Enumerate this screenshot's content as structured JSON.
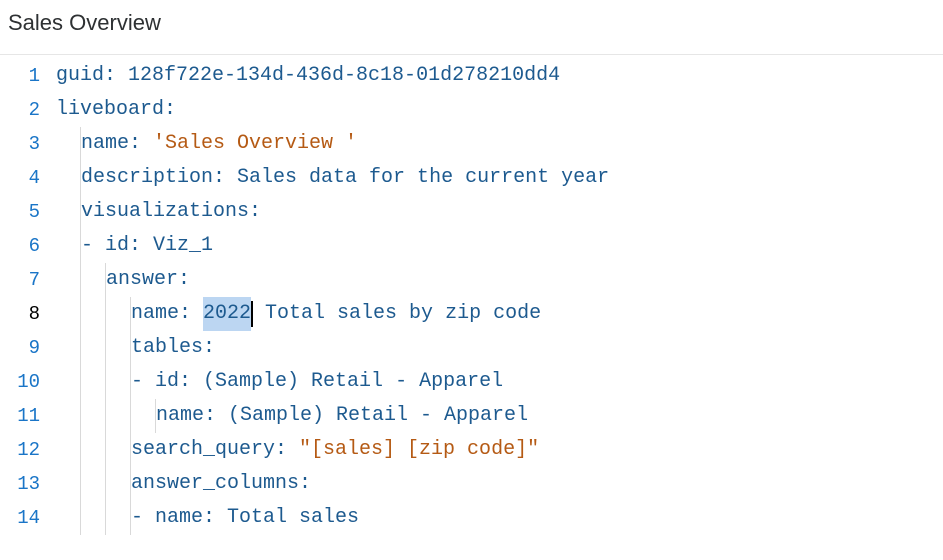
{
  "header": {
    "title": "Sales Overview"
  },
  "code": {
    "lines": [
      {
        "num": "1",
        "indent": 0,
        "guides": [],
        "segments": [
          {
            "t": "key",
            "v": "guid: "
          },
          {
            "t": "val",
            "v": "128f722e-134d-436d-8c18-01d278210dd4"
          }
        ]
      },
      {
        "num": "2",
        "indent": 0,
        "guides": [],
        "segments": [
          {
            "t": "key",
            "v": "liveboard:"
          }
        ]
      },
      {
        "num": "3",
        "indent": 2,
        "guides": [
          1
        ],
        "segments": [
          {
            "t": "key",
            "v": "name: "
          },
          {
            "t": "str",
            "v": "'Sales Overview '"
          }
        ]
      },
      {
        "num": "4",
        "indent": 2,
        "guides": [
          1
        ],
        "segments": [
          {
            "t": "key",
            "v": "description: "
          },
          {
            "t": "val",
            "v": "Sales data for the current year"
          }
        ]
      },
      {
        "num": "5",
        "indent": 2,
        "guides": [
          1
        ],
        "segments": [
          {
            "t": "key",
            "v": "visualizations:"
          }
        ]
      },
      {
        "num": "6",
        "indent": 2,
        "guides": [
          1
        ],
        "segments": [
          {
            "t": "dash",
            "v": "- "
          },
          {
            "t": "key",
            "v": "id: "
          },
          {
            "t": "val",
            "v": "Viz_1"
          }
        ]
      },
      {
        "num": "7",
        "indent": 4,
        "guides": [
          1,
          2
        ],
        "segments": [
          {
            "t": "key",
            "v": "answer:"
          }
        ]
      },
      {
        "num": "8",
        "indent": 6,
        "guides": [
          1,
          2,
          3
        ],
        "current": true,
        "segments": [
          {
            "t": "key",
            "v": "name: "
          },
          {
            "t": "sel",
            "v": "2022"
          },
          {
            "t": "cursor",
            "v": ""
          },
          {
            "t": "val",
            "v": " Total sales by zip code"
          }
        ]
      },
      {
        "num": "9",
        "indent": 6,
        "guides": [
          1,
          2,
          3
        ],
        "segments": [
          {
            "t": "key",
            "v": "tables:"
          }
        ]
      },
      {
        "num": "10",
        "indent": 6,
        "guides": [
          1,
          2,
          3
        ],
        "segments": [
          {
            "t": "dash",
            "v": "- "
          },
          {
            "t": "key",
            "v": "id: "
          },
          {
            "t": "val",
            "v": "(Sample) Retail - Apparel"
          }
        ]
      },
      {
        "num": "11",
        "indent": 8,
        "guides": [
          1,
          2,
          3,
          4
        ],
        "segments": [
          {
            "t": "key",
            "v": "name: "
          },
          {
            "t": "val",
            "v": "(Sample) Retail - Apparel"
          }
        ]
      },
      {
        "num": "12",
        "indent": 6,
        "guides": [
          1,
          2,
          3
        ],
        "segments": [
          {
            "t": "key",
            "v": "search_query: "
          },
          {
            "t": "str",
            "v": "\"[sales] [zip code]\""
          }
        ]
      },
      {
        "num": "13",
        "indent": 6,
        "guides": [
          1,
          2,
          3
        ],
        "segments": [
          {
            "t": "key",
            "v": "answer_columns:"
          }
        ]
      },
      {
        "num": "14",
        "indent": 6,
        "guides": [
          1,
          2,
          3
        ],
        "segments": [
          {
            "t": "dash",
            "v": "- "
          },
          {
            "t": "key",
            "v": "name: "
          },
          {
            "t": "val",
            "v": "Total sales"
          }
        ]
      }
    ]
  }
}
